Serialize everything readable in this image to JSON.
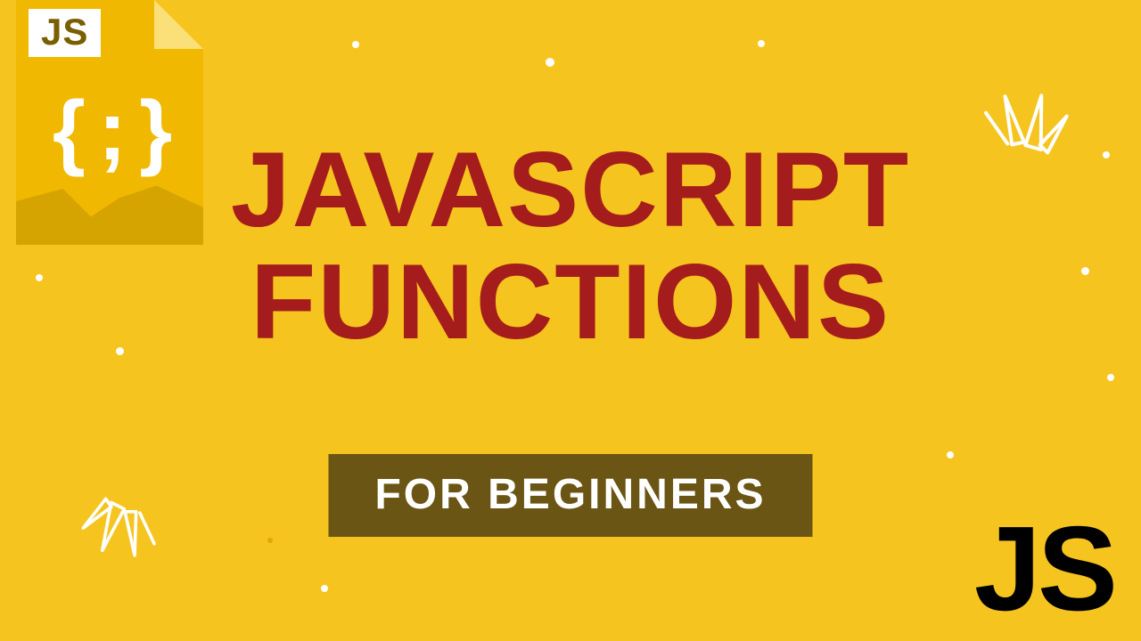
{
  "title": {
    "line1": "JAVASCRIPT",
    "line2": "FUNCTIONS"
  },
  "subtitle": "FOR BEGINNERS",
  "badge": {
    "label": "JS",
    "braces": "{ ; }"
  },
  "bottom_label": "JS",
  "colors": {
    "background": "#f6c41e",
    "title": "#a51c1c",
    "subtitle_bg": "#6b5514",
    "subtitle_text": "#ffffff",
    "accent_dark": "#000000"
  }
}
